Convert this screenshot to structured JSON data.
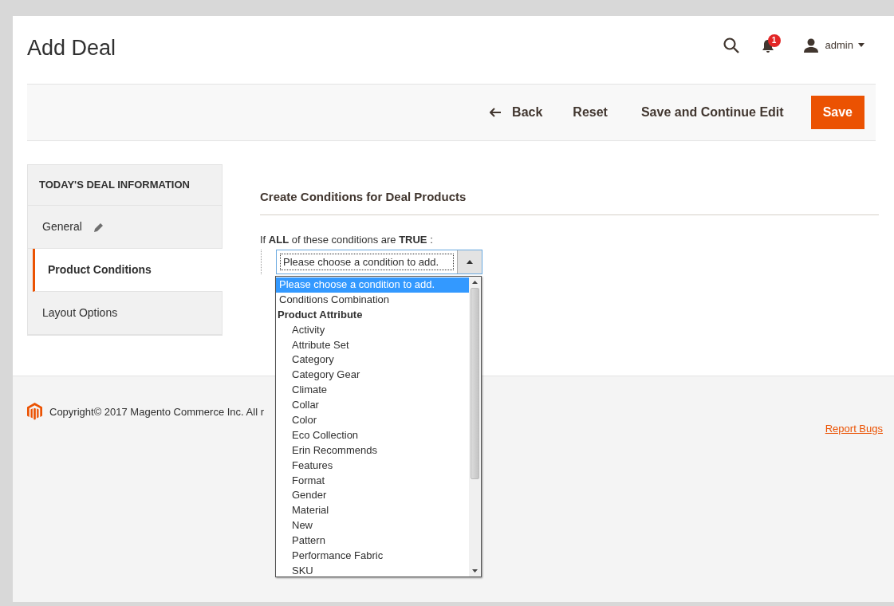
{
  "header": {
    "title": "Add Deal",
    "notification_count": "1",
    "user": "admin"
  },
  "actions": [
    {
      "label": "Back",
      "kind": "back"
    },
    {
      "label": "Reset",
      "kind": "plain"
    },
    {
      "label": "Save and Continue Edit",
      "kind": "plain"
    },
    {
      "label": "Save",
      "kind": "primary"
    }
  ],
  "sidebar": {
    "title": "TODAY'S DEAL INFORMATION",
    "items": [
      {
        "label": "General",
        "selected": false,
        "edited": true
      },
      {
        "label": "Product Conditions",
        "selected": true,
        "edited": false
      },
      {
        "label": "Layout Options",
        "selected": false,
        "edited": false
      }
    ]
  },
  "section": {
    "title": "Create Conditions for Deal Products",
    "rule": "If **ALL**  of these conditions are **TRUE** :",
    "select_value": "Please choose a condition to add.",
    "expanded": true,
    "options": [
      {
        "label": "Please choose a condition to add.",
        "selected": true
      },
      {
        "label": "Conditions Combination",
        "selected": false
      },
      {
        "label": "Product Attribute",
        "selected": false,
        "children": [
          {
            "label": "Activity",
            "selected": false
          },
          {
            "label": "Attribute Set",
            "selected": false
          },
          {
            "label": "Category",
            "selected": false
          },
          {
            "label": "Category Gear",
            "selected": false
          },
          {
            "label": "Climate",
            "selected": false
          },
          {
            "label": "Collar",
            "selected": false
          },
          {
            "label": "Color",
            "selected": false
          },
          {
            "label": "Eco Collection",
            "selected": false
          },
          {
            "label": "Erin Recommends",
            "selected": false
          },
          {
            "label": "Features",
            "selected": false
          },
          {
            "label": "Format",
            "selected": false
          },
          {
            "label": "Gender",
            "selected": false
          },
          {
            "label": "Material",
            "selected": false
          },
          {
            "label": "New",
            "selected": false
          },
          {
            "label": "Pattern",
            "selected": false
          },
          {
            "label": "Performance Fabric",
            "selected": false
          },
          {
            "label": "SKU",
            "selected": false
          }
        ]
      }
    ]
  },
  "footer": {
    "copyright": "Copyright© 2017 Magento Commerce Inc. All r",
    "report_link": "Report Bugs"
  }
}
